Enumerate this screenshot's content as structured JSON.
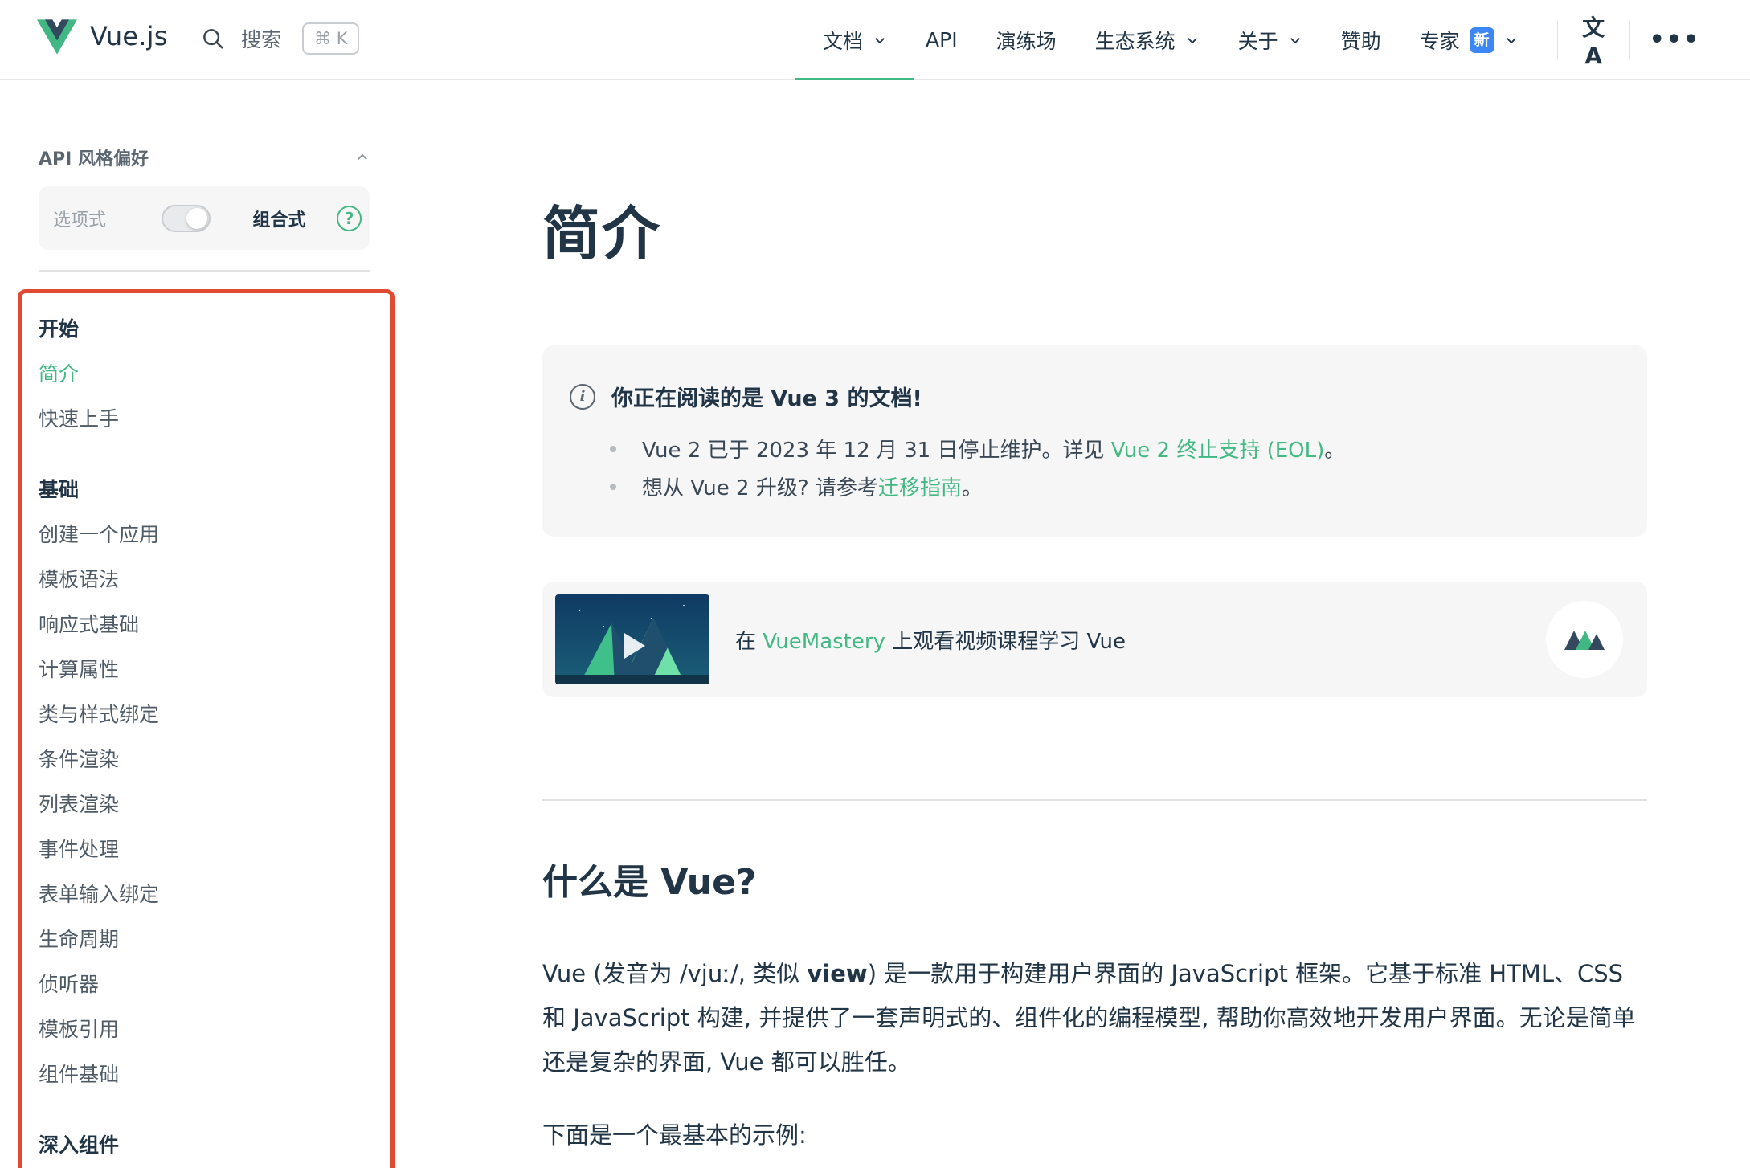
{
  "nav": {
    "brand": "Vue.js",
    "search_label": "搜索",
    "search_shortcut": "⌘ K",
    "items": [
      {
        "label": "文档",
        "dropdown": true,
        "active": true
      },
      {
        "label": "API",
        "dropdown": false
      },
      {
        "label": "演练场",
        "dropdown": false
      },
      {
        "label": "生态系统",
        "dropdown": true
      },
      {
        "label": "关于",
        "dropdown": true
      },
      {
        "label": "赞助",
        "dropdown": false
      },
      {
        "label": "专家",
        "dropdown": true,
        "badge": "新"
      }
    ],
    "translate_icon": "文A",
    "more_icon": "•••"
  },
  "sidebar": {
    "pref_title": "API 风格偏好",
    "pref_options": {
      "left": "选项式",
      "right": "组合式",
      "help": "?"
    },
    "sections": [
      {
        "title": "开始",
        "items": [
          "简介",
          "快速上手"
        ],
        "active": "简介"
      },
      {
        "title": "基础",
        "items": [
          "创建一个应用",
          "模板语法",
          "响应式基础",
          "计算属性",
          "类与样式绑定",
          "条件渲染",
          "列表渲染",
          "事件处理",
          "表单输入绑定",
          "生命周期",
          "侦听器",
          "模板引用",
          "组件基础"
        ]
      },
      {
        "title": "深入组件",
        "items": []
      }
    ]
  },
  "main": {
    "title": "简介",
    "info": {
      "icon": "i",
      "heading": "你正在阅读的是 Vue 3 的文档!",
      "line1_prefix": "Vue 2 已于 2023 年 12 月 31 日停止维护。详见 ",
      "line1_link": "Vue 2 终止支持 (EOL)",
      "line1_suffix": "。",
      "line2_prefix": "想从 Vue 2 升级? 请参考",
      "line2_link": "迁移指南",
      "line2_suffix": "。"
    },
    "vuemastery": {
      "prefix": "在 ",
      "link": "VueMastery",
      "suffix": " 上观看视频课程学习 Vue"
    },
    "h2": "什么是 Vue?",
    "para": {
      "p1": "Vue (发音为 /vjuː/, 类似 ",
      "bold": "view",
      "p2": ") 是一款用于构建用户界面的 JavaScript 框架。它基于标准 HTML、CSS 和 JavaScript 构建, 并提供了一套声明式的、组件化的编程模型, 帮助你高效地开发用户界面。无论是简单还是复杂的界面, Vue 都可以胜任。"
    },
    "para2": "下面是一个最基本的示例:"
  },
  "colors": {
    "accent": "#42b883",
    "text": "#213547",
    "highlight_box": "#e04a33",
    "badge": "#3d87f5"
  }
}
